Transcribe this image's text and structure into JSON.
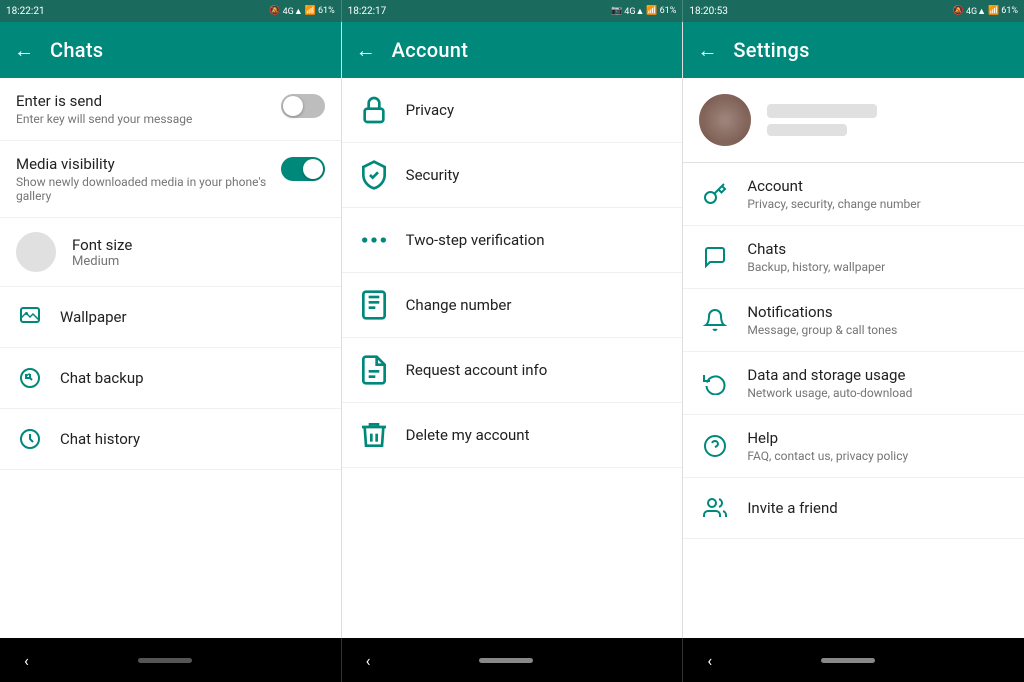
{
  "panels": [
    {
      "id": "chats",
      "statusTime": "18:22:21",
      "statusIcons": "🔕 4G▲ 61%",
      "title": "Chats",
      "items": [
        {
          "type": "toggle",
          "label": "Enter is send",
          "desc": "Enter key will send your message",
          "state": "off"
        },
        {
          "type": "toggle",
          "label": "Media visibility",
          "desc": "Show newly downloaded media in your phone's gallery",
          "state": "on"
        },
        {
          "type": "fontsize",
          "label": "Font size",
          "value": "Medium"
        },
        {
          "type": "icon-row",
          "label": "Wallpaper",
          "icon": "wallpaper"
        },
        {
          "type": "icon-row",
          "label": "Chat backup",
          "icon": "backup"
        },
        {
          "type": "icon-row",
          "label": "Chat history",
          "icon": "history"
        }
      ]
    },
    {
      "id": "account",
      "statusTime": "18:22:17",
      "statusIcons": "📷 4G▲ 61%",
      "title": "Account",
      "items": [
        {
          "label": "Privacy",
          "icon": "lock"
        },
        {
          "label": "Security",
          "icon": "shield"
        },
        {
          "label": "Two-step verification",
          "icon": "dots"
        },
        {
          "label": "Change number",
          "icon": "phone"
        },
        {
          "label": "Request account info",
          "icon": "doc"
        },
        {
          "label": "Delete my account",
          "icon": "trash"
        }
      ]
    },
    {
      "id": "settings",
      "statusTime": "18:20:53",
      "statusIcons": "📷 4G▲ 61%",
      "title": "Settings",
      "profile": {
        "nameBlurred": true,
        "statusBlurred": true
      },
      "items": [
        {
          "label": "Account",
          "desc": "Privacy, security, change number",
          "icon": "key"
        },
        {
          "label": "Chats",
          "desc": "Backup, history, wallpaper",
          "icon": "chat"
        },
        {
          "label": "Notifications",
          "desc": "Message, group & call tones",
          "icon": "bell"
        },
        {
          "label": "Data and storage usage",
          "desc": "Network usage, auto-download",
          "icon": "refresh"
        },
        {
          "label": "Help",
          "desc": "FAQ, contact us, privacy policy",
          "icon": "help"
        },
        {
          "label": "Invite a friend",
          "desc": "",
          "icon": "people"
        }
      ]
    }
  ],
  "nav": {
    "chevron": "‹",
    "pill1": "",
    "pill2": ""
  }
}
